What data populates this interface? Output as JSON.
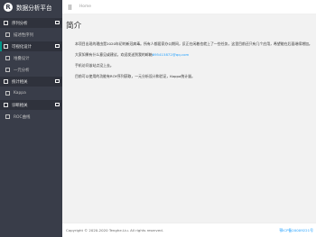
{
  "brand": {
    "logo_letter": "R",
    "title": "数据分析平台"
  },
  "sidebar": {
    "groups": [
      {
        "label": "序列分析",
        "items": [
          {
            "label": "描述性序列"
          }
        ]
      },
      {
        "label": "可视化设计",
        "items": [
          {
            "label": "堆叠设计"
          },
          {
            "label": "一元分析"
          }
        ]
      },
      {
        "label": "统计相关",
        "items": [
          {
            "label": "Kappa"
          }
        ]
      },
      {
        "label": "诊断相关",
        "items": [
          {
            "label": "ROC曲线"
          }
        ]
      }
    ]
  },
  "header": {
    "breadcrumb": "Home"
  },
  "main": {
    "title": "简介",
    "paragraphs": {
      "p1": "本项目出现的理由是2020年初的新冠病毒。所有人都居家办公期间，反正在闲着也就上了一些任务，这里目前还只有几个应用，希望能在后面继续增加。",
      "p2_prefix": "大家如果有什么意见或建议，欢迎发送到我的邮箱",
      "p2_email": "695415872@qq.com",
      "p3": "手机访问该站点没上去。",
      "p4": "目前可以使用的功能有ROY序列获取，一元分析设计和验证，Kappa统计量。"
    }
  },
  "footer": {
    "copyright": "Copyright © 2020-2020 Tenghe.Liu. All rights reserved.",
    "icp": "鄂ICP备20009221号"
  }
}
